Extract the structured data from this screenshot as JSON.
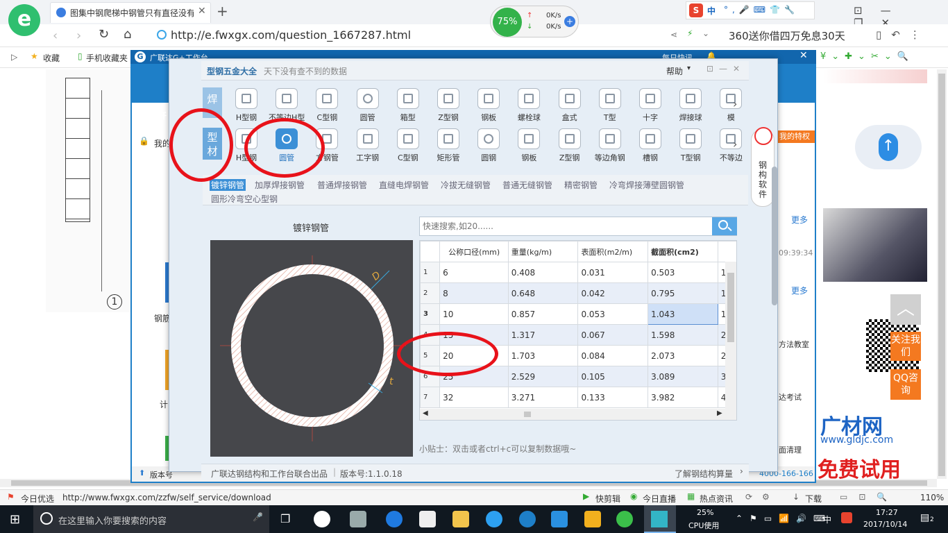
{
  "browser": {
    "tab_title": "图集中钢爬梯中钢管只有直径没有",
    "speed_percent": "75%",
    "up_speed": "0K/s",
    "down_speed": "0K/s",
    "url": "http://e.fwxgx.com/question_1667287.html",
    "ad_text": "360送你借四万免息30天",
    "bookmarks": [
      "收藏",
      "手机收藏夹"
    ],
    "status_items": [
      "今日优选",
      "http://www.fwxgx.com/zzfw/self_service/download",
      "快剪辑",
      "今日直播",
      "热点资讯",
      "下载",
      "110%"
    ]
  },
  "outer_window": {
    "title": "广联达G+工作台",
    "daily_sign": "每日快讯",
    "left_texts": [
      "开",
      "我的",
      "办",
      "新",
      "钢筋",
      "推",
      "计"
    ],
    "version_label": "版本号",
    "right_texts": [
      "更多",
      "09:39:34",
      "承",
      "更多",
      "下载",
      "专",
      "方法教室",
      "达考试",
      "面清理",
      "广材网",
      "www.gldjc.com",
      "免费试用",
      "我的特权"
    ],
    "phone": "4000-166-166"
  },
  "dialog": {
    "title": "型钢五金大全",
    "subtitle": "天下没有查不到的数据",
    "help": "帮助",
    "side_tabs": [
      "焊",
      "型材"
    ],
    "row1_icons": [
      "H型钢",
      "不等边H型",
      "C型钢",
      "圆管",
      "箱型",
      "Z型钢",
      "钢板",
      "螺栓球",
      "盒式",
      "T型",
      "十字",
      "焊接球",
      "模"
    ],
    "row2_icons": [
      "H型钢",
      "圆管",
      "方钢管",
      "工字钢",
      "C型钢",
      "矩形管",
      "圆钢",
      "钢板",
      "Z型钢",
      "等边角钢",
      "槽钢",
      "T型钢",
      "不等边"
    ],
    "mascot_text": "钢构软件",
    "subcats": [
      "镀锌钢管",
      "加厚焊接钢管",
      "普通焊接钢管",
      "直缝电焊钢管",
      "冷拔无缝钢管",
      "普通无缝钢管",
      "精密钢管",
      "冷弯焊接薄壁圆钢管",
      "圆形冷弯空心型钢"
    ],
    "panel_title": "镀锌钢管",
    "diagram_labels": {
      "d": "D",
      "t": "t"
    },
    "search_placeholder": "快速搜索,如20......",
    "table": {
      "headers": [
        "公称口径(mm)",
        "重量(kg/m)",
        "表面积(m2/m)",
        "截面积(cm2)"
      ],
      "rows": [
        {
          "n": "1",
          "c": [
            "6",
            "0.408",
            "0.031",
            "0.503",
            "1"
          ]
        },
        {
          "n": "2",
          "c": [
            "8",
            "0.648",
            "0.042",
            "0.795",
            "1"
          ]
        },
        {
          "n": "3",
          "c": [
            "10",
            "0.857",
            "0.053",
            "1.043",
            "1"
          ]
        },
        {
          "n": "4",
          "c": [
            "15",
            "1.317",
            "0.067",
            "1.598",
            "2"
          ]
        },
        {
          "n": "5",
          "c": [
            "20",
            "1.703",
            "0.084",
            "2.073",
            "2"
          ]
        },
        {
          "n": "6",
          "c": [
            "25",
            "2.529",
            "0.105",
            "3.089",
            "3"
          ]
        },
        {
          "n": "7",
          "c": [
            "32",
            "3.271",
            "0.133",
            "3.982",
            "4"
          ]
        }
      ]
    },
    "tip": "小贴士：双击或者ctrl+c可以复制数据哦~",
    "footer_left": "广联达钢结构和工作台联合出品",
    "footer_version": "版本号:1.1.0.18",
    "footer_right": "了解钢结构算量"
  },
  "right_buttons": [
    "关注我们",
    "QQ咨询"
  ],
  "taskbar": {
    "search_placeholder": "在这里输入你要搜索的内容",
    "cpu": "25%",
    "cpu_label": "CPU使用",
    "ime": "中",
    "time": "17:27",
    "date": "2017/10/14",
    "notif": "2"
  },
  "colors": {
    "accent_blue": "#1e7fc8",
    "annotation_red": "#e8121a",
    "orange": "#f47920"
  }
}
